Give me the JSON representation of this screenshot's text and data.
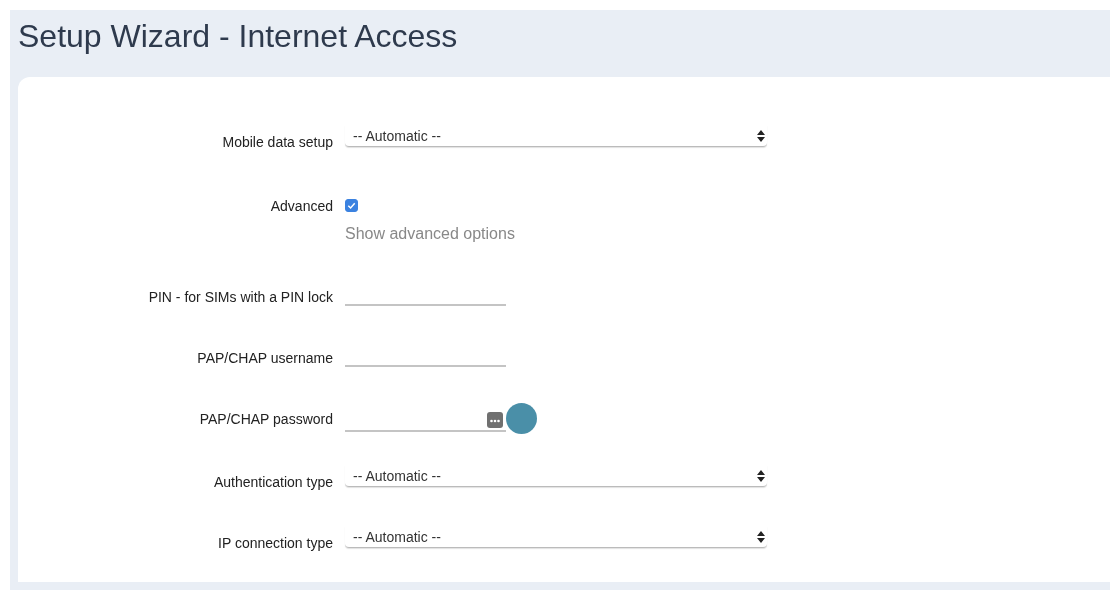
{
  "page": {
    "title": "Setup Wizard - Internet Access"
  },
  "fields": [
    {
      "kind": "select",
      "label": "Mobile data setup",
      "value": "-- Automatic --"
    },
    {
      "kind": "checkbox",
      "label": "Advanced",
      "checked": true,
      "help": "Show advanced options"
    },
    {
      "kind": "text",
      "label": "PIN - for SIMs with a PIN lock"
    },
    {
      "kind": "text",
      "label": "PAP/CHAP username"
    },
    {
      "kind": "password",
      "label": "PAP/CHAP password"
    },
    {
      "kind": "select",
      "label": "Authentication type",
      "value": "-- Automatic --"
    },
    {
      "kind": "select",
      "label": "IP connection type",
      "value": "-- Automatic --"
    }
  ]
}
